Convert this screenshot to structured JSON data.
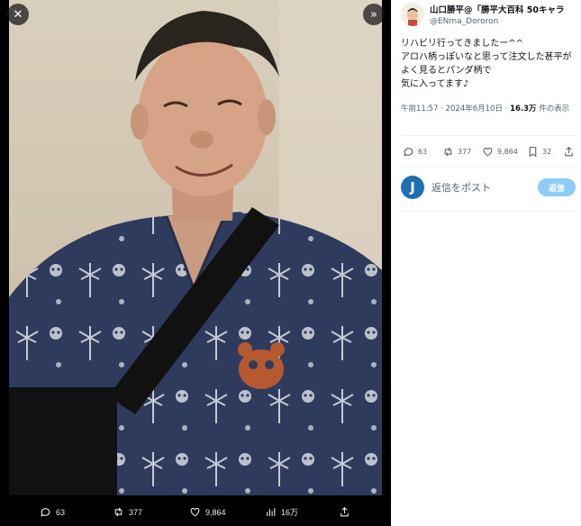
{
  "viewer": {
    "close_icon": "close-icon",
    "expand_icon": "expand-icon",
    "actions": {
      "replies": "63",
      "retweets": "377",
      "likes": "9,864",
      "views": "16万"
    }
  },
  "tweet": {
    "display_name": "山口勝平@「勝平大百科 50キャラ",
    "handle": "@ENma_Dororon",
    "text": "リハビリ行ってきましたー^^\nアロハ柄っぽいなと思って注文した甚平がよく見るとパンダ柄で\n気に入ってます♪",
    "timestamp": "午前11:57 · 2024年6月10日 · ",
    "views_count": "16.3万",
    "views_label": " 件の表示",
    "actions": {
      "replies": "63",
      "retweets": "377",
      "likes": "9,864",
      "bookmarks": "32"
    }
  },
  "reply_box": {
    "avatar_letter": "J",
    "placeholder": "返信をポスト",
    "button_label": "返信"
  },
  "colors": {
    "viewer_bg": "#000000",
    "reply_button": "#8ecdf8",
    "text_secondary": "#536471",
    "shirt": "#2f3b5c"
  }
}
